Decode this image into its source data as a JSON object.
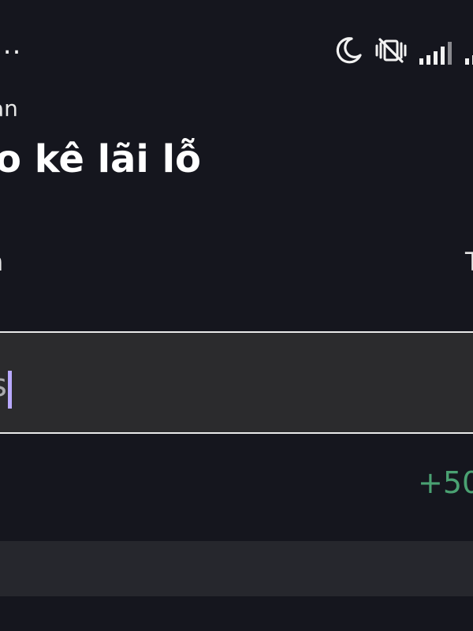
{
  "status_bar": {
    "overflow_dots": "...",
    "icons": [
      "moon-icon",
      "vibrate-off-icon",
      "signal-icon",
      "signal-icon"
    ]
  },
  "header": {
    "breadcrumb": "an",
    "title": "o kê lãi lỗ",
    "sub_label": "n",
    "sub_right": "T"
  },
  "search": {
    "value": "s"
  },
  "row": {
    "change": "+50"
  },
  "colors": {
    "background": "#15161e",
    "input_background": "#2b2b2d",
    "caret": "#b9a9ff",
    "positive": "#4aa172",
    "band": "#26272d"
  }
}
